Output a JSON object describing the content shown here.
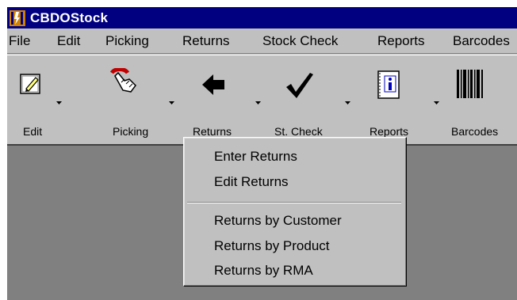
{
  "window": {
    "title": "CBDOStock"
  },
  "menubar": {
    "items": [
      "File",
      "Edit",
      "Picking",
      "Returns",
      "Stock Check",
      "Reports",
      "Barcodes"
    ]
  },
  "toolbar": {
    "buttons": [
      {
        "label": "Edit",
        "icon": "edit-pencil-icon"
      },
      {
        "label": "Picking",
        "icon": "hand-picking-icon"
      },
      {
        "label": "Returns",
        "icon": "return-arrow-icon"
      },
      {
        "label": "St. Check",
        "icon": "checkmark-icon"
      },
      {
        "label": "Reports",
        "icon": "reports-book-icon"
      },
      {
        "label": "Barcodes",
        "icon": "barcode-icon"
      }
    ]
  },
  "returns_menu": {
    "group1": [
      "Enter Returns",
      "Edit Returns"
    ],
    "group2": [
      "Returns by Customer",
      "Returns by Product",
      "Returns by RMA"
    ]
  }
}
